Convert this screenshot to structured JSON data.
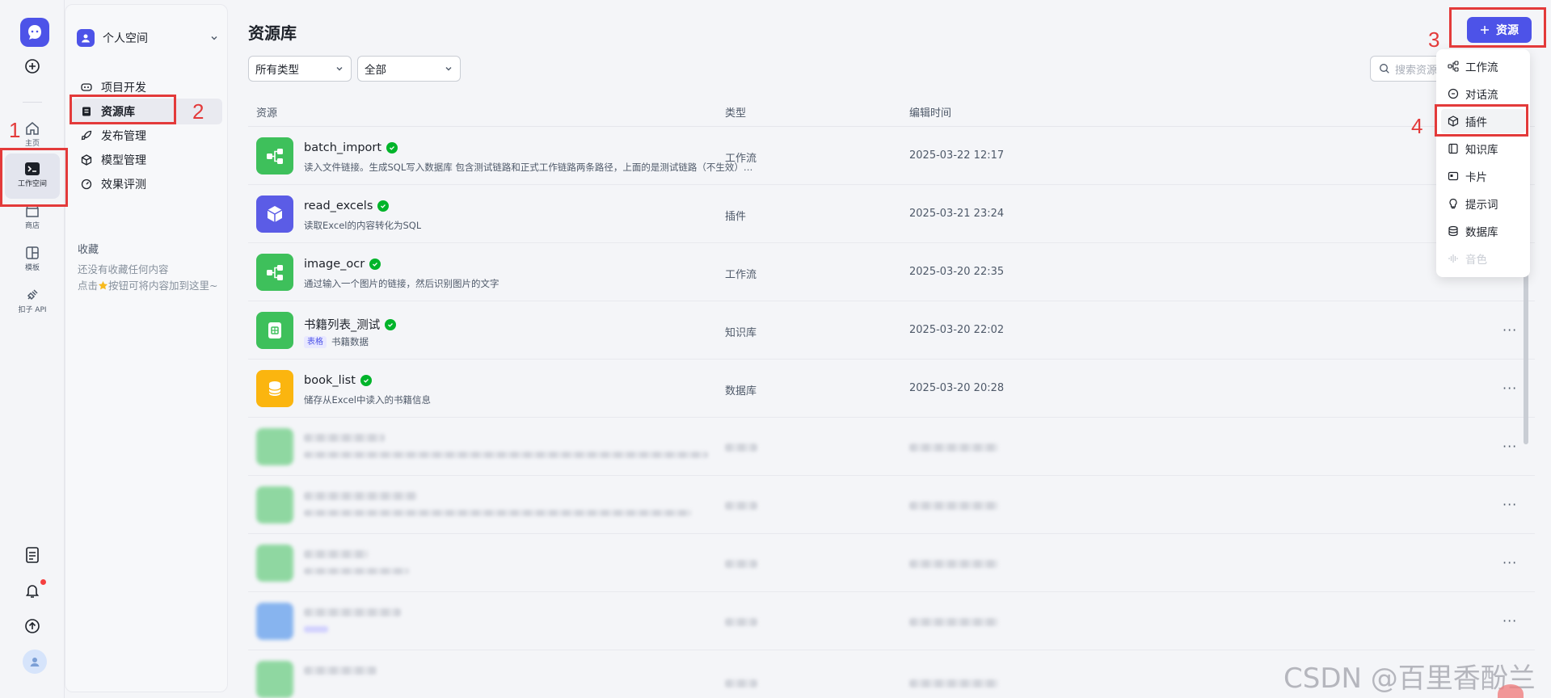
{
  "rail": {
    "items": [
      {
        "label": "主页"
      },
      {
        "label": "工作空间"
      },
      {
        "label": "商店"
      },
      {
        "label": "模板"
      },
      {
        "label": "扣子 API"
      }
    ]
  },
  "sidebar": {
    "space_name": "个人空间",
    "nav": [
      {
        "label": "项目开发"
      },
      {
        "label": "资源库"
      },
      {
        "label": "发布管理"
      },
      {
        "label": "模型管理"
      },
      {
        "label": "效果评测"
      }
    ],
    "favorites_title": "收藏",
    "favorites_empty": "还没有收藏任何内容",
    "favorites_hint_pre": "点击",
    "favorites_hint_post": "按钮可将内容加到这里~"
  },
  "main": {
    "title": "资源库",
    "filter_type": "所有类型",
    "filter_scope": "全部",
    "search_placeholder": "搜索资源",
    "add_button": "资源",
    "columns": {
      "resource": "资源",
      "type": "类型",
      "edited": "编辑时间"
    },
    "rows": [
      {
        "name": "batch_import",
        "desc": "读入文件链接。生成SQL写入数据库 包含测试链路和正式工作链路两条路径，上面的是测试链路（不生效）…",
        "type": "工作流",
        "time": "2025-03-22 12:17",
        "color": "#3ec05b"
      },
      {
        "name": "read_excels",
        "desc": "读取Excel的内容转化为SQL",
        "type": "插件",
        "time": "2025-03-21 23:24",
        "color": "#5b5ce6"
      },
      {
        "name": "image_ocr",
        "desc": "通过输入一个图片的链接，然后识别图片的文字",
        "type": "工作流",
        "time": "2025-03-20 22:35",
        "color": "#3ec05b"
      },
      {
        "name": "书籍列表_测试",
        "tag": "表格",
        "desc": "书籍数据",
        "type": "知识库",
        "time": "2025-03-20 22:02",
        "color": "#3ec05b"
      },
      {
        "name": "book_list",
        "desc": "储存从Excel中读入的书籍信息",
        "type": "数据库",
        "time": "2025-03-20 20:28",
        "color": "#fbb50f"
      }
    ]
  },
  "menu": {
    "items": [
      {
        "label": "工作流"
      },
      {
        "label": "对话流"
      },
      {
        "label": "插件"
      },
      {
        "label": "知识库"
      },
      {
        "label": "卡片"
      },
      {
        "label": "提示词"
      },
      {
        "label": "数据库"
      },
      {
        "label": "音色"
      }
    ]
  },
  "annotations": [
    "1",
    "2",
    "3",
    "4"
  ],
  "watermark": "CSDN @百里香酚兰"
}
